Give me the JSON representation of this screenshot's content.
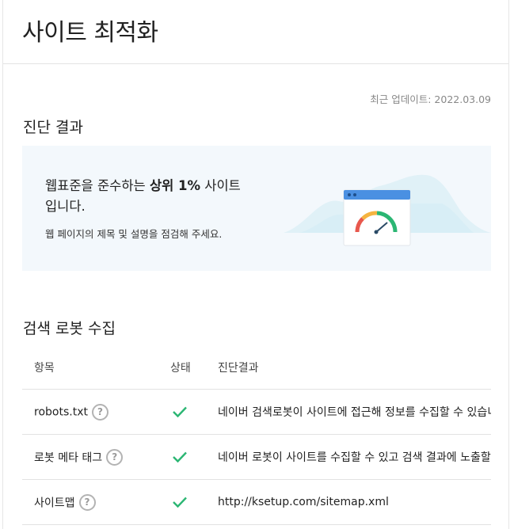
{
  "page": {
    "title": "사이트 최적화",
    "last_updated": "최근 업데이트: 2022.03.09"
  },
  "diagnosis": {
    "heading": "진단 결과",
    "line1_prefix": "웹표준을 준수하는 ",
    "line1_strong": "상위 1%",
    "line1_suffix": " 사이트",
    "line2": "입니다.",
    "subtext": "웹 페이지의 제목 및 설명을 점검해 주세요."
  },
  "crawl": {
    "heading": "검색 로봇 수집",
    "columns": [
      "항목",
      "상태",
      "진단결과"
    ],
    "rows": [
      {
        "item": "robots.txt",
        "status": "ok",
        "result": "네이버 검색로봇이 사이트에 접근해 정보를 수집할 수 있습니다."
      },
      {
        "item": "로봇 메타 태그",
        "status": "ok",
        "result": "네이버 로봇이 사이트를 수집할 수 있고 검색 결과에 노출할 수 있습니다."
      },
      {
        "item": "사이트맵",
        "status": "ok",
        "result": "http://ksetup.com/sitemap.xml"
      }
    ]
  },
  "icons": {
    "help": "question-circle-icon",
    "status_ok": "check-icon"
  },
  "colors": {
    "check": "#2bb673",
    "banner_bg": "#f3f8fc",
    "browser_bar": "#4a90e2"
  }
}
